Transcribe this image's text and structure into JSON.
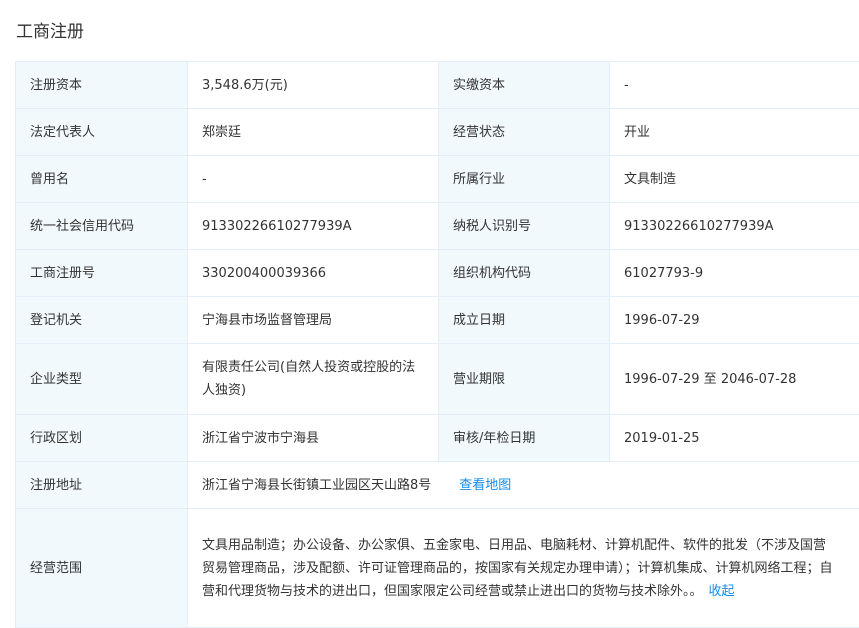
{
  "section_title": "工商注册",
  "rows": [
    {
      "l1": "注册资本",
      "v1": "3,548.6万(元)",
      "l2": "实缴资本",
      "v2": "-"
    },
    {
      "l1": "法定代表人",
      "v1": "郑崇廷",
      "l2": "经营状态",
      "v2": "开业"
    },
    {
      "l1": "曾用名",
      "v1": "-",
      "l2": "所属行业",
      "v2": "文具制造"
    },
    {
      "l1": "统一社会信用代码",
      "v1": "91330226610277939A",
      "l2": "纳税人识别号",
      "v2": "91330226610277939A"
    },
    {
      "l1": "工商注册号",
      "v1": "330200400039366",
      "l2": "组织机构代码",
      "v2": "61027793-9"
    },
    {
      "l1": "登记机关",
      "v1": "宁海县市场监督管理局",
      "l2": "成立日期",
      "v2": "1996-07-29"
    },
    {
      "l1": "企业类型",
      "v1": "有限责任公司(自然人投资或控股的法人独资)",
      "l2": "营业期限",
      "v2": "1996-07-29 至 2046-07-28"
    },
    {
      "l1": "行政区划",
      "v1": "浙江省宁波市宁海县",
      "l2": "审核/年检日期",
      "v2": "2019-01-25"
    }
  ],
  "address": {
    "label": "注册地址",
    "value": "浙江省宁海县长街镇工业园区天山路8号",
    "map_link": "查看地图"
  },
  "scope": {
    "label": "经营范围",
    "value": "文具用品制造；办公设备、办公家俱、五金家电、日用品、电脑耗材、计算机配件、软件的批发（不涉及国营贸易管理商品，涉及配额、许可证管理商品的，按国家有关规定办理申请）；计算机集成、计算机网络工程；自营和代理货物与技术的进出口，但国家限定公司经营或禁止进出口的货物与技术除外。。",
    "collapse_link": "收起"
  }
}
